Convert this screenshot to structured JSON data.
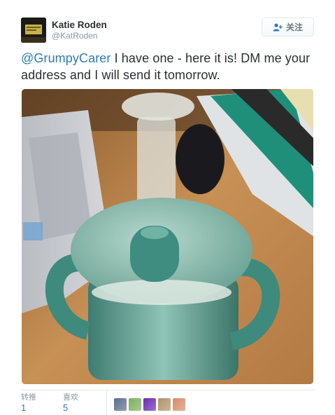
{
  "author": {
    "name": "Katie Roden",
    "handle": "@KatRoden"
  },
  "follow_button": {
    "icon": "add-user-icon",
    "label": "关注"
  },
  "tweet": {
    "mention": "@GrumpyCarer",
    "body": " I have one - here it is! DM me your address and I will send it tomorrow."
  },
  "photo": {
    "subject": "teal sippy cup with handles on a wooden desk"
  },
  "stats": {
    "retweets_label": "转推",
    "retweets_count": "1",
    "likes_label": "喜欢",
    "likes_count": "5"
  },
  "likers": [
    {
      "name": "liker-avatar-1",
      "color": "#5a6e8a"
    },
    {
      "name": "liker-avatar-2",
      "color": "#7fae5f"
    },
    {
      "name": "liker-avatar-3",
      "color": "#6a2bb0"
    },
    {
      "name": "liker-avatar-4",
      "color": "#b0936a"
    },
    {
      "name": "liker-avatar-5",
      "color": "#d98a6a"
    }
  ]
}
